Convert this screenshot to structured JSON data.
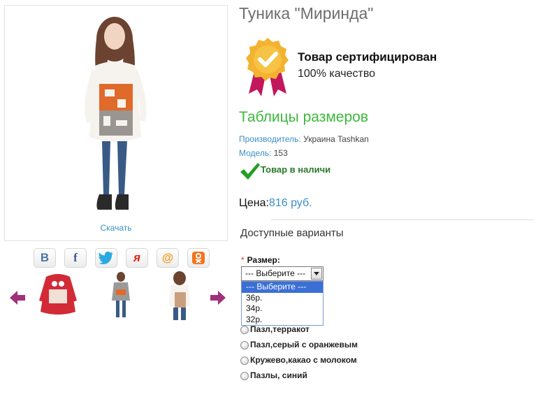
{
  "product": {
    "title": "Туника \"Миринда\"",
    "download_label": "Скачать",
    "certification": {
      "title": "Товар сертифицирован",
      "subtitle": "100% качество"
    },
    "size_table_link": "Таблицы размеров",
    "manufacturer": {
      "label": "Производитель:",
      "value": "Украина Tashkan"
    },
    "model": {
      "label": "Модель:",
      "value": "153"
    },
    "stock_status": "Товар в наличи",
    "price": {
      "label": "Цена:",
      "value": "816 руб."
    },
    "variants_heading": "Доступные варианты"
  },
  "share": [
    {
      "name": "vk-icon",
      "glyph": "В",
      "color": "#4c75a3"
    },
    {
      "name": "facebook-icon",
      "glyph": "f",
      "color": "#3b5998"
    },
    {
      "name": "twitter-icon",
      "glyph": "🐦",
      "color": "#2aa9e0"
    },
    {
      "name": "moikrug-icon",
      "glyph": "я",
      "color": "#e1251b"
    },
    {
      "name": "mailru-icon",
      "glyph": "@",
      "color": "#f49a1a"
    },
    {
      "name": "odnoklassniki-icon",
      "glyph": "ок",
      "color": "#f4731c"
    }
  ],
  "size_select": {
    "label": "Размер:",
    "required_mark": "*",
    "selected": "--- Выберите ---",
    "options": [
      "--- Выберите ---",
      "36р.",
      "34р.",
      "32р."
    ]
  },
  "color_options": [
    "Пазл,терракот",
    "Пазл,серый с оранжевым",
    "Кружево,какао с молоком",
    "Пазлы, синий"
  ],
  "colors": {
    "link_blue": "#3b8fc5",
    "size_table_green": "#3cb83c",
    "stock_green": "#2a7a2a",
    "nav_arrow": "#a0307a"
  }
}
